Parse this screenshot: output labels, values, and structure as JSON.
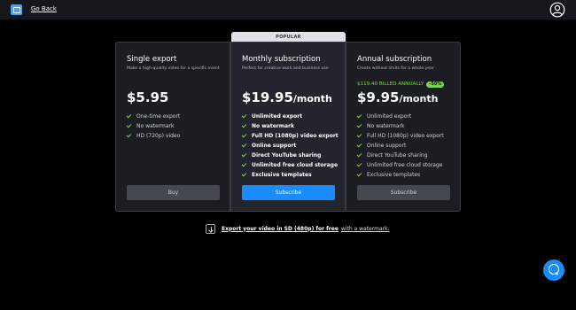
{
  "header": {
    "go_back_label": "Go Back"
  },
  "popular_label": "POPULAR",
  "plans": [
    {
      "title": "Single export",
      "subtitle": "Make a high-quality video for a specific event",
      "price": "$5.95",
      "features": [
        "One-time export",
        "No watermark",
        "HD (720p) video"
      ],
      "button_label": "Buy"
    },
    {
      "title": "Monthly subscription",
      "subtitle": "Perfect for creative work and business use",
      "price": "$19.95",
      "period": "/month",
      "features": [
        "Unlimited export",
        "No watermark",
        "Full HD (1080p) video export",
        "Online support",
        "Direct YouTube sharing",
        "Unlimited free cloud storage",
        "Exclusive templates"
      ],
      "button_label": "Subscribe"
    },
    {
      "title": "Annual subscription",
      "subtitle": "Create without limits for a whole year",
      "billed": "$119.40 BILLED ANNUALLY",
      "discount": "-50%",
      "price": "$9.95",
      "period": "/month",
      "features": [
        "Unlimited export",
        "No watermark",
        "Full HD (1080p) video export",
        "Online support",
        "Direct YouTube sharing",
        "Unlimited free cloud storage",
        "Exclusive templates"
      ],
      "button_label": "Subscribe"
    }
  ],
  "free_export": {
    "link_text": "Export your video in SD (480p) for free",
    "rest_text": "with a watermark."
  },
  "colors": {
    "accent": "#1a8cff",
    "check": "#7fd34a",
    "background": "#000000"
  }
}
